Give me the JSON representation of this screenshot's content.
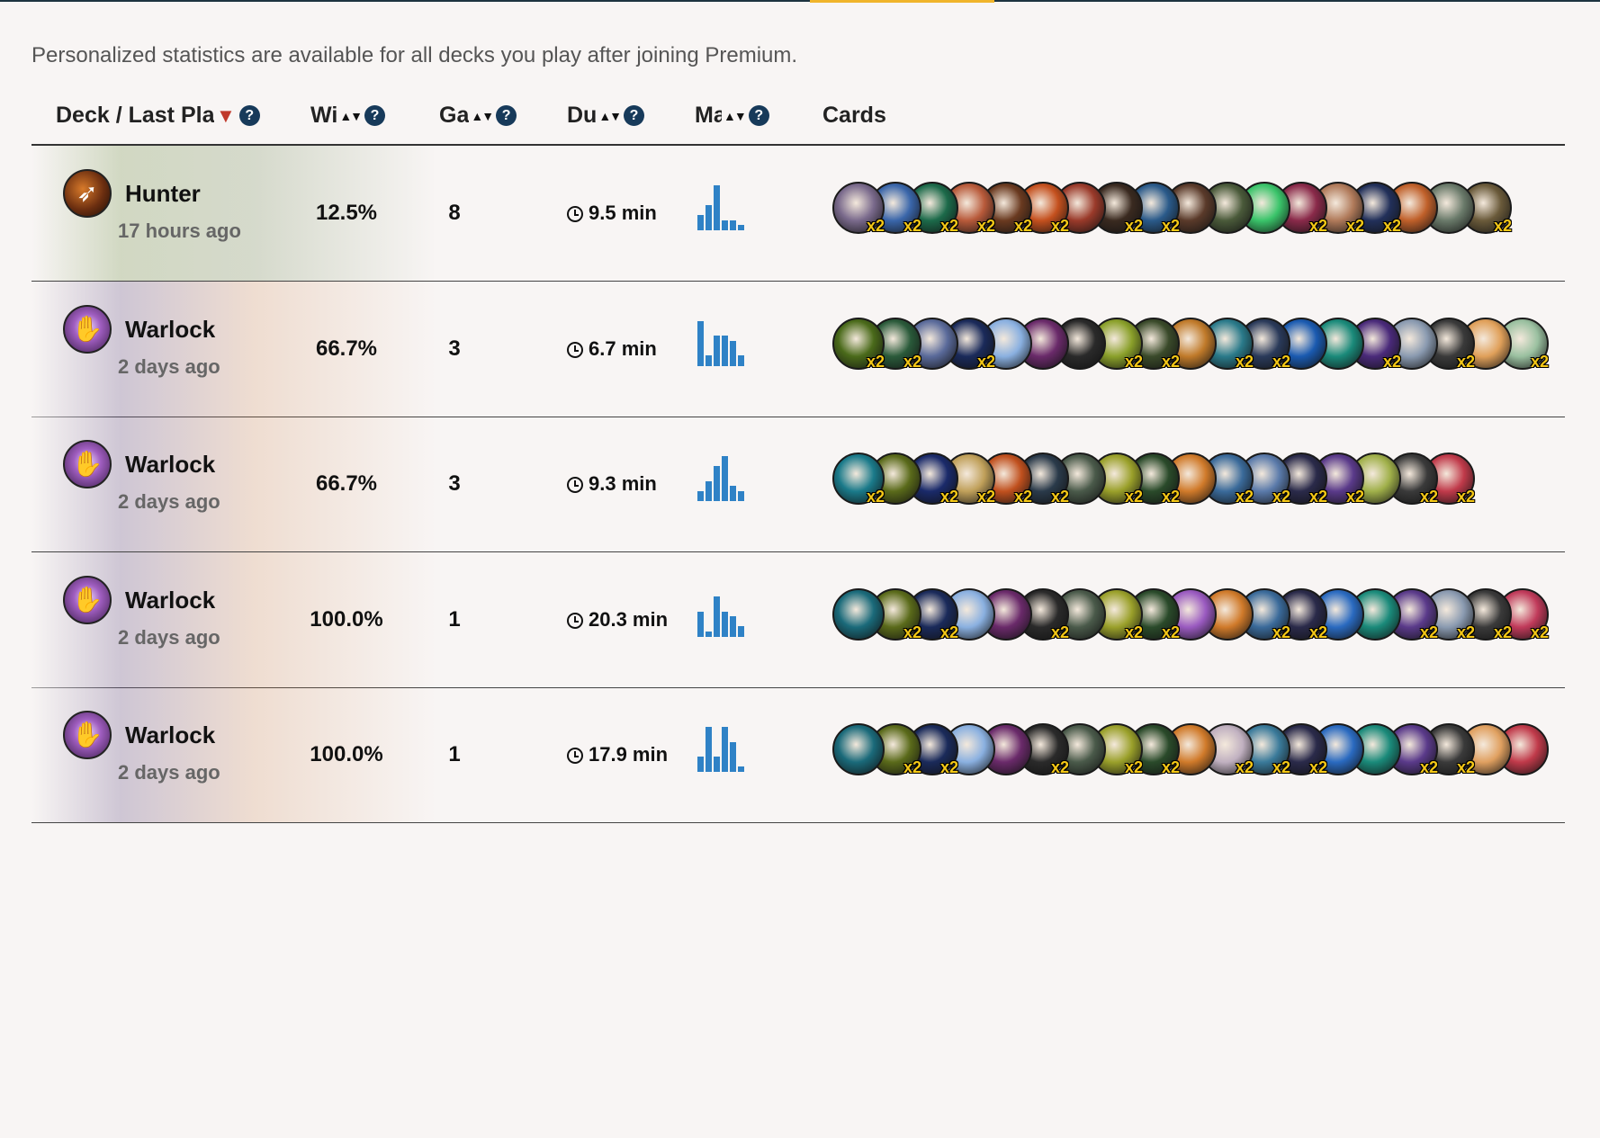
{
  "notice": "Personalized statistics are available for all decks you play after joining Premium.",
  "columns": {
    "deck": "Deck / Last Pla",
    "winrate": "Wi",
    "games": "Ga",
    "duration": "Du",
    "mana": "Ma",
    "cards": "Cards"
  },
  "colors": {
    "accent": "#f0b42a",
    "mana_bar": "#2f82c6",
    "sort_active": "#c0392b",
    "help_icon": "#173a5a",
    "x2_badge": "#f5c816"
  },
  "decks": [
    {
      "class": "Hunter",
      "icon": "hunter-bow-icon",
      "last_played": "17 hours ago",
      "winrate": "12.5%",
      "games": "8",
      "duration": "9.5 min",
      "mana_curve": [
        3,
        5,
        9,
        2,
        2,
        1
      ],
      "cards": [
        {
          "c": "#7a6a8c",
          "x2": "x2"
        },
        {
          "c": "#3a66aa",
          "x2": "x2"
        },
        {
          "c": "#1c6a4a",
          "x2": "x2"
        },
        {
          "c": "#b85a3a",
          "x2": "x2"
        },
        {
          "c": "#6a3a20",
          "x2": "x2"
        },
        {
          "c": "#c4501e",
          "x2": "x2"
        },
        {
          "c": "#9a3a2a",
          "x2": ""
        },
        {
          "c": "#3a2a20",
          "x2": "x2"
        },
        {
          "c": "#2a5a8a",
          "x2": "x2"
        },
        {
          "c": "#5a3a2a",
          "x2": ""
        },
        {
          "c": "#4a5a3a",
          "x2": ""
        },
        {
          "c": "#3ac46a",
          "x2": ""
        },
        {
          "c": "#8a2a4a",
          "x2": "x2"
        },
        {
          "c": "#b07a5a",
          "x2": "x2"
        },
        {
          "c": "#22305a",
          "x2": "x2"
        },
        {
          "c": "#c0602a",
          "x2": ""
        },
        {
          "c": "#6a7a6a",
          "x2": ""
        },
        {
          "c": "#6a5a3a",
          "x2": "x2"
        }
      ]
    },
    {
      "class": "Warlock",
      "icon": "warlock-hand-icon",
      "last_played": "2 days ago",
      "winrate": "66.7%",
      "games": "3",
      "duration": "6.7 min",
      "mana_curve": [
        9,
        2,
        6,
        6,
        5,
        2
      ],
      "cards": [
        {
          "c": "#4a6a1a",
          "x2": "x2"
        },
        {
          "c": "#2a5a3a",
          "x2": "x2"
        },
        {
          "c": "#5a6a9a",
          "x2": ""
        },
        {
          "c": "#1a2a5a",
          "x2": "x2"
        },
        {
          "c": "#8ab0e0",
          "x2": ""
        },
        {
          "c": "#6a2a6a",
          "x2": ""
        },
        {
          "c": "#2a2a2a",
          "x2": ""
        },
        {
          "c": "#8aa02a",
          "x2": "x2"
        },
        {
          "c": "#3a4a2a",
          "x2": "x2"
        },
        {
          "c": "#c07a2a",
          "x2": ""
        },
        {
          "c": "#2a7a8a",
          "x2": "x2"
        },
        {
          "c": "#2a3a5a",
          "x2": "x2"
        },
        {
          "c": "#1a5ab0",
          "x2": ""
        },
        {
          "c": "#1a8a7a",
          "x2": ""
        },
        {
          "c": "#4a2a7a",
          "x2": "x2"
        },
        {
          "c": "#8a9ab0",
          "x2": ""
        },
        {
          "c": "#3a3a3a",
          "x2": "x2"
        },
        {
          "c": "#e0a05a",
          "x2": ""
        },
        {
          "c": "#9ac0a0",
          "x2": "x2"
        }
      ]
    },
    {
      "class": "Warlock",
      "icon": "warlock-hand-icon",
      "last_played": "2 days ago",
      "winrate": "66.7%",
      "games": "3",
      "duration": "9.3 min",
      "mana_curve": [
        2,
        4,
        7,
        9,
        3,
        2
      ],
      "cards": [
        {
          "c": "#1a7a8a",
          "x2": "x2"
        },
        {
          "c": "#5a6a1a",
          "x2": ""
        },
        {
          "c": "#1a2a6a",
          "x2": "x2"
        },
        {
          "c": "#c0a05a",
          "x2": "x2"
        },
        {
          "c": "#c0501e",
          "x2": "x2"
        },
        {
          "c": "#2a3a4a",
          "x2": "x2"
        },
        {
          "c": "#4a5a4a",
          "x2": ""
        },
        {
          "c": "#9aa02a",
          "x2": "x2"
        },
        {
          "c": "#2a4a2a",
          "x2": "x2"
        },
        {
          "c": "#d07a2a",
          "x2": ""
        },
        {
          "c": "#3a6a9a",
          "x2": "x2"
        },
        {
          "c": "#5a7aaa",
          "x2": "x2"
        },
        {
          "c": "#2a2a4a",
          "x2": "x2"
        },
        {
          "c": "#5a3a8a",
          "x2": "x2"
        },
        {
          "c": "#a0b04a",
          "x2": ""
        },
        {
          "c": "#3a3a3a",
          "x2": "x2"
        },
        {
          "c": "#c03a4a",
          "x2": "x2"
        }
      ]
    },
    {
      "class": "Warlock",
      "icon": "warlock-hand-icon",
      "last_played": "2 days ago",
      "winrate": "100.0%",
      "games": "1",
      "duration": "20.3 min",
      "mana_curve": [
        5,
        1,
        8,
        5,
        4,
        2
      ],
      "cards": [
        {
          "c": "#1a6a7a",
          "x2": ""
        },
        {
          "c": "#5a6a1a",
          "x2": "x2"
        },
        {
          "c": "#1a2a5a",
          "x2": "x2"
        },
        {
          "c": "#8ab0e0",
          "x2": ""
        },
        {
          "c": "#6a2a6a",
          "x2": ""
        },
        {
          "c": "#2a2a2a",
          "x2": "x2"
        },
        {
          "c": "#4a5a4a",
          "x2": ""
        },
        {
          "c": "#9aa02a",
          "x2": "x2"
        },
        {
          "c": "#2a4a2a",
          "x2": "x2"
        },
        {
          "c": "#9a5ac0",
          "x2": ""
        },
        {
          "c": "#d07a2a",
          "x2": ""
        },
        {
          "c": "#3a6a9a",
          "x2": "x2"
        },
        {
          "c": "#2a2a4a",
          "x2": "x2"
        },
        {
          "c": "#2a6ac0",
          "x2": ""
        },
        {
          "c": "#1a8a7a",
          "x2": ""
        },
        {
          "c": "#5a3a8a",
          "x2": "x2"
        },
        {
          "c": "#8a9ab0",
          "x2": "x2"
        },
        {
          "c": "#3a3a3a",
          "x2": "x2"
        },
        {
          "c": "#c03a5a",
          "x2": "x2"
        }
      ]
    },
    {
      "class": "Warlock",
      "icon": "warlock-hand-icon",
      "last_played": "2 days ago",
      "winrate": "100.0%",
      "games": "1",
      "duration": "17.9 min",
      "mana_curve": [
        3,
        9,
        3,
        9,
        6,
        1
      ],
      "cards": [
        {
          "c": "#1a6a7a",
          "x2": ""
        },
        {
          "c": "#5a6a1a",
          "x2": "x2"
        },
        {
          "c": "#1a2a5a",
          "x2": "x2"
        },
        {
          "c": "#8ab0e0",
          "x2": ""
        },
        {
          "c": "#6a2a6a",
          "x2": ""
        },
        {
          "c": "#2a2a2a",
          "x2": "x2"
        },
        {
          "c": "#4a5a4a",
          "x2": ""
        },
        {
          "c": "#9aa02a",
          "x2": "x2"
        },
        {
          "c": "#2a4a2a",
          "x2": "x2"
        },
        {
          "c": "#d07a2a",
          "x2": ""
        },
        {
          "c": "#c0b0c0",
          "x2": "x2"
        },
        {
          "c": "#3a7a9a",
          "x2": "x2"
        },
        {
          "c": "#2a2a4a",
          "x2": "x2"
        },
        {
          "c": "#2a6ac0",
          "x2": ""
        },
        {
          "c": "#1a8a7a",
          "x2": ""
        },
        {
          "c": "#5a3a8a",
          "x2": "x2"
        },
        {
          "c": "#3a3a3a",
          "x2": "x2"
        },
        {
          "c": "#e0a060",
          "x2": ""
        },
        {
          "c": "#c03a4a",
          "x2": ""
        }
      ]
    }
  ]
}
